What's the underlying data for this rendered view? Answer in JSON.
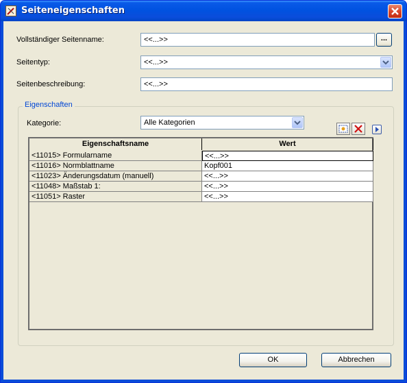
{
  "window": {
    "title": "Seiteneigenschaften"
  },
  "form": {
    "fullname_label": "Vollständiger Seitenname:",
    "fullname_value": "<<...>>",
    "browse_label": "...",
    "type_label": "Seitentyp:",
    "type_value": "<<...>>",
    "desc_label": "Seitenbeschreibung:",
    "desc_value": "<<...>>"
  },
  "properties": {
    "group_title": "Eigenschaften",
    "category_label": "Kategorie:",
    "category_value": "Alle Kategorien",
    "columns": [
      "Eigenschaftsname",
      "Wert"
    ],
    "rows": [
      {
        "name": "<11015> Formularname",
        "value": "<<...>>"
      },
      {
        "name": "<11016> Normblattname",
        "value": "Kopf001"
      },
      {
        "name": "<11023> Änderungsdatum (manuell)",
        "value": "<<...>>"
      },
      {
        "name": "<11048> Maßstab 1:",
        "value": "<<...>>"
      },
      {
        "name": "<11051> Raster",
        "value": "<<...>>"
      }
    ]
  },
  "buttons": {
    "ok": "OK",
    "cancel": "Abbrechen"
  },
  "colors": {
    "titlebar": "#0052e0",
    "dialog_bg": "#ece9d8",
    "group_title": "#0046d5"
  }
}
